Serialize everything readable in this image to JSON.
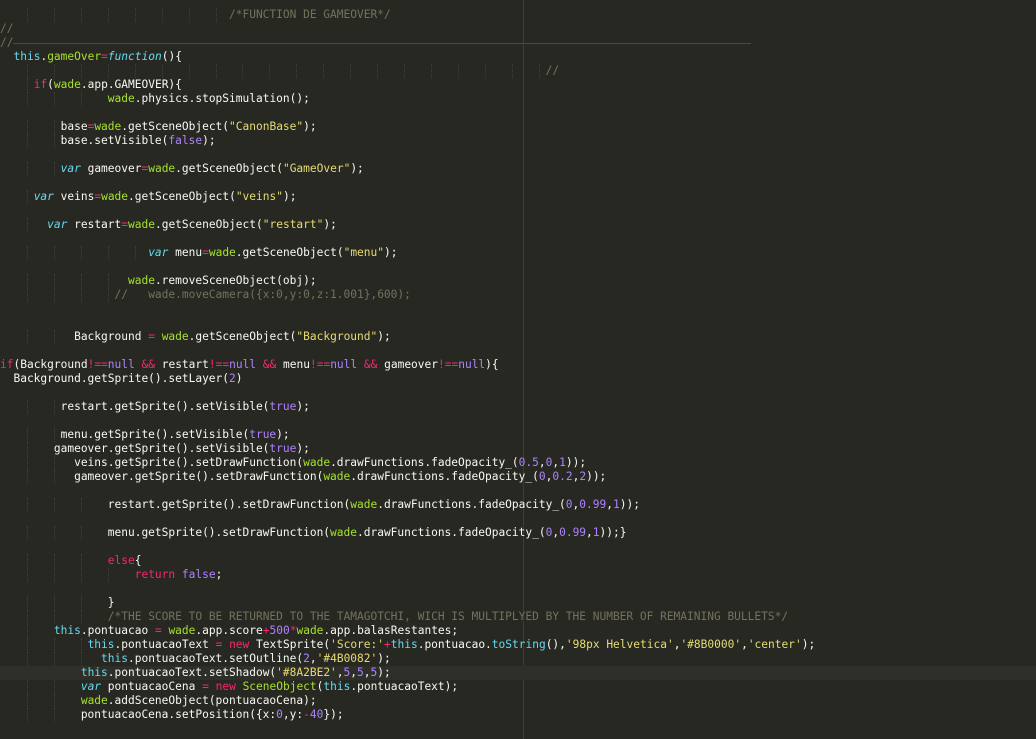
{
  "theme": {
    "background": "#272822",
    "plain": "#f8f8f2",
    "keyword": "#f92672",
    "string": "#e6db74",
    "number": "#ae81ff",
    "comment": "#75715e",
    "function": "#a6e22e",
    "storage": "#66d9ef"
  },
  "editor": {
    "language": "javascript",
    "current_line": 47,
    "lines": [
      {
        "tokens": [
          [
            "cm",
            "                                  /*FUNCTION DE GAMEOVER*/"
          ]
        ]
      },
      {
        "tokens": [
          [
            "cm",
            "//"
          ]
        ]
      },
      {
        "tokens": [
          [
            "cm",
            "//"
          ]
        ],
        "separator": true
      },
      {
        "tokens": [
          [
            "pl",
            "  "
          ],
          [
            "th",
            "this"
          ],
          [
            "pl",
            "."
          ],
          [
            "fn",
            "gameOver"
          ],
          [
            "kw",
            "="
          ],
          [
            "it",
            "function"
          ],
          [
            "pl",
            "(){"
          ]
        ]
      },
      {
        "tokens": [
          [
            "pl",
            "                                                                                 "
          ],
          [
            "cm",
            "//"
          ]
        ]
      },
      {
        "tokens": [
          [
            "pl",
            "     "
          ],
          [
            "kw",
            "if"
          ],
          [
            "pl",
            "("
          ],
          [
            "fn",
            "wade"
          ],
          [
            "pl",
            ".app.GAMEOVER){"
          ]
        ]
      },
      {
        "tokens": [
          [
            "pl",
            "                "
          ],
          [
            "fn",
            "wade"
          ],
          [
            "pl",
            ".physics.stopSimulation();"
          ]
        ]
      },
      {
        "tokens": []
      },
      {
        "tokens": [
          [
            "pl",
            "         base"
          ],
          [
            "kw",
            "="
          ],
          [
            "fn",
            "wade"
          ],
          [
            "pl",
            ".getSceneObject("
          ],
          [
            "st",
            "\"CanonBase\""
          ],
          [
            "pl",
            ");"
          ]
        ]
      },
      {
        "tokens": [
          [
            "pl",
            "         base.setVisible("
          ],
          [
            "nm",
            "false"
          ],
          [
            "pl",
            ");"
          ]
        ]
      },
      {
        "tokens": []
      },
      {
        "tokens": [
          [
            "pl",
            "         "
          ],
          [
            "it",
            "var"
          ],
          [
            "pl",
            " gameover"
          ],
          [
            "kw",
            "="
          ],
          [
            "fn",
            "wade"
          ],
          [
            "pl",
            ".getSceneObject("
          ],
          [
            "st",
            "\"GameOver\""
          ],
          [
            "pl",
            ");"
          ]
        ]
      },
      {
        "tokens": []
      },
      {
        "tokens": [
          [
            "pl",
            "     "
          ],
          [
            "it",
            "var"
          ],
          [
            "pl",
            " veins"
          ],
          [
            "kw",
            "="
          ],
          [
            "fn",
            "wade"
          ],
          [
            "pl",
            ".getSceneObject("
          ],
          [
            "st",
            "\"veins\""
          ],
          [
            "pl",
            ");"
          ]
        ]
      },
      {
        "tokens": []
      },
      {
        "tokens": [
          [
            "pl",
            "       "
          ],
          [
            "it",
            "var"
          ],
          [
            "pl",
            " restart"
          ],
          [
            "kw",
            "="
          ],
          [
            "fn",
            "wade"
          ],
          [
            "pl",
            ".getSceneObject("
          ],
          [
            "st",
            "\"restart\""
          ],
          [
            "pl",
            ");"
          ]
        ]
      },
      {
        "tokens": []
      },
      {
        "tokens": [
          [
            "pl",
            "                      "
          ],
          [
            "it",
            "var"
          ],
          [
            "pl",
            " menu"
          ],
          [
            "kw",
            "="
          ],
          [
            "fn",
            "wade"
          ],
          [
            "pl",
            ".getSceneObject("
          ],
          [
            "st",
            "\"menu\""
          ],
          [
            "pl",
            ");"
          ]
        ]
      },
      {
        "tokens": []
      },
      {
        "tokens": [
          [
            "pl",
            "                   "
          ],
          [
            "fn",
            "wade"
          ],
          [
            "pl",
            ".removeSceneObject(obj);"
          ]
        ]
      },
      {
        "tokens": [
          [
            "pl",
            "                 "
          ],
          [
            "cm",
            "//   wade.moveCamera({x:0,y:0,z:1.001},600);"
          ]
        ]
      },
      {
        "tokens": []
      },
      {
        "tokens": []
      },
      {
        "tokens": [
          [
            "pl",
            "           Background "
          ],
          [
            "kw",
            "="
          ],
          [
            "pl",
            " "
          ],
          [
            "fn",
            "wade"
          ],
          [
            "pl",
            ".getSceneObject("
          ],
          [
            "st",
            "\"Background\""
          ],
          [
            "pl",
            ");"
          ]
        ]
      },
      {
        "tokens": []
      },
      {
        "tokens": [
          [
            "kw",
            "if"
          ],
          [
            "pl",
            "(Background"
          ],
          [
            "kw",
            "!=="
          ],
          [
            "nm",
            "null"
          ],
          [
            "pl",
            " "
          ],
          [
            "kw",
            "&&"
          ],
          [
            "pl",
            " restart"
          ],
          [
            "kw",
            "!=="
          ],
          [
            "nm",
            "null"
          ],
          [
            "pl",
            " "
          ],
          [
            "kw",
            "&&"
          ],
          [
            "pl",
            " menu"
          ],
          [
            "kw",
            "!=="
          ],
          [
            "nm",
            "null"
          ],
          [
            "pl",
            " "
          ],
          [
            "kw",
            "&&"
          ],
          [
            "pl",
            " gameover"
          ],
          [
            "kw",
            "!=="
          ],
          [
            "nm",
            "null"
          ],
          [
            "pl",
            "){"
          ]
        ]
      },
      {
        "tokens": [
          [
            "pl",
            "  Background.getSprite().setLayer("
          ],
          [
            "nm",
            "2"
          ],
          [
            "pl",
            ")"
          ]
        ]
      },
      {
        "tokens": []
      },
      {
        "tokens": [
          [
            "pl",
            "         restart.getSprite().setVisible("
          ],
          [
            "nm",
            "true"
          ],
          [
            "pl",
            ");"
          ]
        ]
      },
      {
        "tokens": []
      },
      {
        "tokens": [
          [
            "pl",
            "         menu.getSprite().setVisible("
          ],
          [
            "nm",
            "true"
          ],
          [
            "pl",
            ");"
          ]
        ]
      },
      {
        "tokens": [
          [
            "pl",
            "        gameover.getSprite().setVisible("
          ],
          [
            "nm",
            "true"
          ],
          [
            "pl",
            ");"
          ]
        ]
      },
      {
        "tokens": [
          [
            "pl",
            "           veins.getSprite().setDrawFunction("
          ],
          [
            "fn",
            "wade"
          ],
          [
            "pl",
            ".drawFunctions.fadeOpacity_("
          ],
          [
            "nm",
            "0.5"
          ],
          [
            "pl",
            ","
          ],
          [
            "nm",
            "0"
          ],
          [
            "pl",
            ","
          ],
          [
            "nm",
            "1"
          ],
          [
            "pl",
            "));"
          ]
        ]
      },
      {
        "tokens": [
          [
            "pl",
            "           gameover.getSprite().setDrawFunction("
          ],
          [
            "fn",
            "wade"
          ],
          [
            "pl",
            ".drawFunctions.fadeOpacity_("
          ],
          [
            "nm",
            "0"
          ],
          [
            "pl",
            ","
          ],
          [
            "nm",
            "0.2"
          ],
          [
            "pl",
            ","
          ],
          [
            "nm",
            "2"
          ],
          [
            "pl",
            "));"
          ]
        ]
      },
      {
        "tokens": []
      },
      {
        "tokens": [
          [
            "pl",
            "                restart.getSprite().setDrawFunction("
          ],
          [
            "fn",
            "wade"
          ],
          [
            "pl",
            ".drawFunctions.fadeOpacity_("
          ],
          [
            "nm",
            "0"
          ],
          [
            "pl",
            ","
          ],
          [
            "nm",
            "0.99"
          ],
          [
            "pl",
            ","
          ],
          [
            "nm",
            "1"
          ],
          [
            "pl",
            "));"
          ]
        ]
      },
      {
        "tokens": []
      },
      {
        "tokens": [
          [
            "pl",
            "                menu.getSprite().setDrawFunction("
          ],
          [
            "fn",
            "wade"
          ],
          [
            "pl",
            ".drawFunctions.fadeOpacity_("
          ],
          [
            "nm",
            "0"
          ],
          [
            "pl",
            ","
          ],
          [
            "nm",
            "0.99"
          ],
          [
            "pl",
            ","
          ],
          [
            "nm",
            "1"
          ],
          [
            "pl",
            "));}"
          ]
        ]
      },
      {
        "tokens": []
      },
      {
        "tokens": [
          [
            "pl",
            "                "
          ],
          [
            "kw",
            "else"
          ],
          [
            "pl",
            "{"
          ]
        ]
      },
      {
        "tokens": [
          [
            "pl",
            "                    "
          ],
          [
            "kw",
            "return"
          ],
          [
            "pl",
            " "
          ],
          [
            "nm",
            "false"
          ],
          [
            "pl",
            ";"
          ]
        ]
      },
      {
        "tokens": []
      },
      {
        "tokens": [
          [
            "pl",
            "                }"
          ]
        ]
      },
      {
        "tokens": [
          [
            "pl",
            "                "
          ],
          [
            "cm",
            "/*THE SCORE TO BE RETURNED TO THE TAMAGOTCHI, WICH IS MULTIPLYED BY THE NUMBER OF REMAINING BULLETS*/"
          ]
        ]
      },
      {
        "tokens": [
          [
            "pl",
            "        "
          ],
          [
            "th",
            "this"
          ],
          [
            "pl",
            ".pontuacao "
          ],
          [
            "kw",
            "="
          ],
          [
            "pl",
            " "
          ],
          [
            "fn",
            "wade"
          ],
          [
            "pl",
            ".app.score"
          ],
          [
            "kw",
            "+"
          ],
          [
            "nm",
            "500"
          ],
          [
            "kw",
            "*"
          ],
          [
            "fn",
            "wade"
          ],
          [
            "pl",
            ".app.balasRestantes;"
          ]
        ]
      },
      {
        "tokens": [
          [
            "pl",
            "             "
          ],
          [
            "th",
            "this"
          ],
          [
            "pl",
            ".pontuacaoText "
          ],
          [
            "kw",
            "="
          ],
          [
            "pl",
            " "
          ],
          [
            "kw",
            "new"
          ],
          [
            "pl",
            " TextSprite("
          ],
          [
            "st",
            "'Score:'"
          ],
          [
            "kw",
            "+"
          ],
          [
            "th",
            "this"
          ],
          [
            "pl",
            ".pontuacao."
          ],
          [
            "th",
            "toString"
          ],
          [
            "pl",
            "(),"
          ],
          [
            "st",
            "'98px Helvetica'"
          ],
          [
            "pl",
            ","
          ],
          [
            "st",
            "'#8B0000'"
          ],
          [
            "pl",
            ","
          ],
          [
            "st",
            "'center'"
          ],
          [
            "pl",
            ");"
          ]
        ]
      },
      {
        "tokens": [
          [
            "pl",
            "               "
          ],
          [
            "th",
            "this"
          ],
          [
            "pl",
            ".pontuacaoText.setOutline("
          ],
          [
            "nm",
            "2"
          ],
          [
            "pl",
            ","
          ],
          [
            "st",
            "'#4B0082'"
          ],
          [
            "pl",
            ");"
          ]
        ]
      },
      {
        "tokens": [
          [
            "pl",
            "            "
          ],
          [
            "th",
            "this"
          ],
          [
            "pl",
            ".pontuacaoText.setShadow("
          ],
          [
            "st",
            "'#8A2BE2'"
          ],
          [
            "pl",
            ","
          ],
          [
            "nm",
            "5"
          ],
          [
            "pl",
            ","
          ],
          [
            "nm",
            "5"
          ],
          [
            "pl",
            ","
          ],
          [
            "nm",
            "5"
          ],
          [
            "pl",
            ");"
          ]
        ]
      },
      {
        "tokens": [
          [
            "pl",
            "            "
          ],
          [
            "it",
            "var"
          ],
          [
            "pl",
            " pontuacaoCena "
          ],
          [
            "kw",
            "="
          ],
          [
            "pl",
            " "
          ],
          [
            "kw",
            "new"
          ],
          [
            "pl",
            " "
          ],
          [
            "fn",
            "SceneObject"
          ],
          [
            "pl",
            "("
          ],
          [
            "th",
            "this"
          ],
          [
            "pl",
            ".pontuacaoText);"
          ]
        ]
      },
      {
        "tokens": [
          [
            "pl",
            "            "
          ],
          [
            "fn",
            "wade"
          ],
          [
            "pl",
            ".addSceneObject(pontuacaoCena);"
          ]
        ]
      },
      {
        "tokens": [
          [
            "pl",
            "            pontuacaoCena.setPosition({x:"
          ],
          [
            "nm",
            "0"
          ],
          [
            "pl",
            ",y:"
          ],
          [
            "kw",
            "-"
          ],
          [
            "nm",
            "40"
          ],
          [
            "pl",
            "});"
          ]
        ]
      }
    ]
  }
}
